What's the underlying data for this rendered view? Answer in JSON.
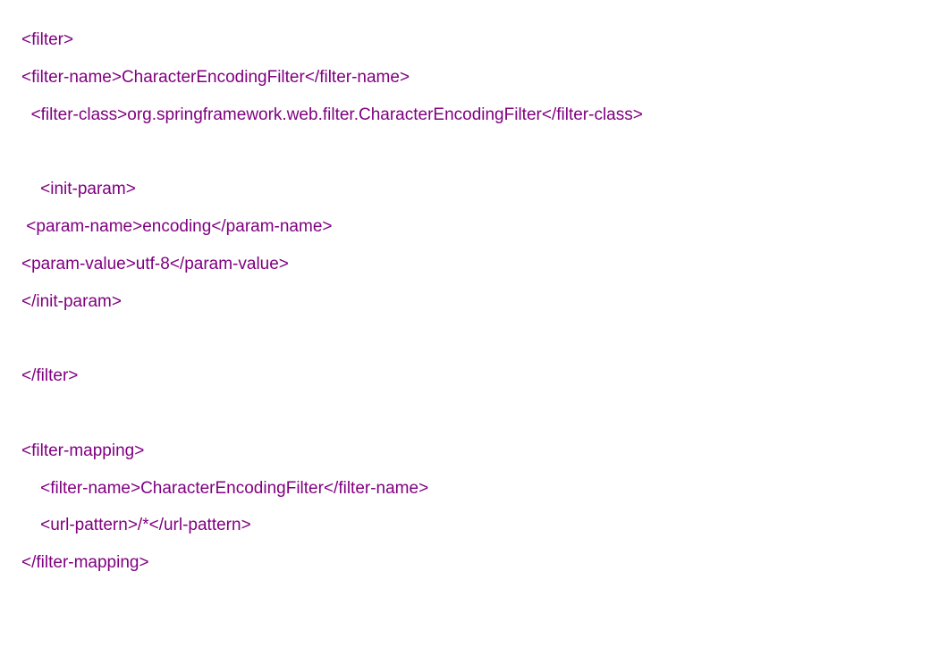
{
  "lines": [
    {
      "indent": "",
      "prefix": "<filter>",
      "content": "",
      "suffix": ""
    },
    {
      "indent": "",
      "prefix": "<filter-name>",
      "content": "CharacterEncodingFilter",
      "suffix": "</filter-name>"
    },
    {
      "indent": "  ",
      "prefix": "<filter-class>",
      "content": "org.springframework.web.filter.CharacterEncodingFilter",
      "suffix": "</filter-class>"
    },
    {
      "indent": "",
      "prefix": "",
      "content": "",
      "suffix": ""
    },
    {
      "indent": "    ",
      "prefix": "<init-param>",
      "content": "",
      "suffix": ""
    },
    {
      "indent": " ",
      "prefix": "<param-name>",
      "content": "encoding",
      "suffix": "</param-name>"
    },
    {
      "indent": "",
      "prefix": "<param-value>",
      "content": "utf-8",
      "suffix": "</param-value>"
    },
    {
      "indent": "",
      "prefix": "</init-param>",
      "content": "",
      "suffix": ""
    },
    {
      "indent": "",
      "prefix": "",
      "content": "",
      "suffix": ""
    },
    {
      "indent": "",
      "prefix": "</filter>",
      "content": "",
      "suffix": ""
    },
    {
      "indent": "",
      "prefix": "",
      "content": "",
      "suffix": ""
    },
    {
      "indent": "",
      "prefix": "<filter-mapping>",
      "content": "",
      "suffix": ""
    },
    {
      "indent": "    ",
      "prefix": "<filter-name>",
      "content": "CharacterEncodingFilter",
      "suffix": "</filter-name>"
    },
    {
      "indent": "    ",
      "prefix": "<url-pattern>",
      "content": "/*",
      "suffix": "</url-pattern>"
    },
    {
      "indent": "",
      "prefix": "</filter-mapping>",
      "content": "",
      "suffix": ""
    }
  ]
}
